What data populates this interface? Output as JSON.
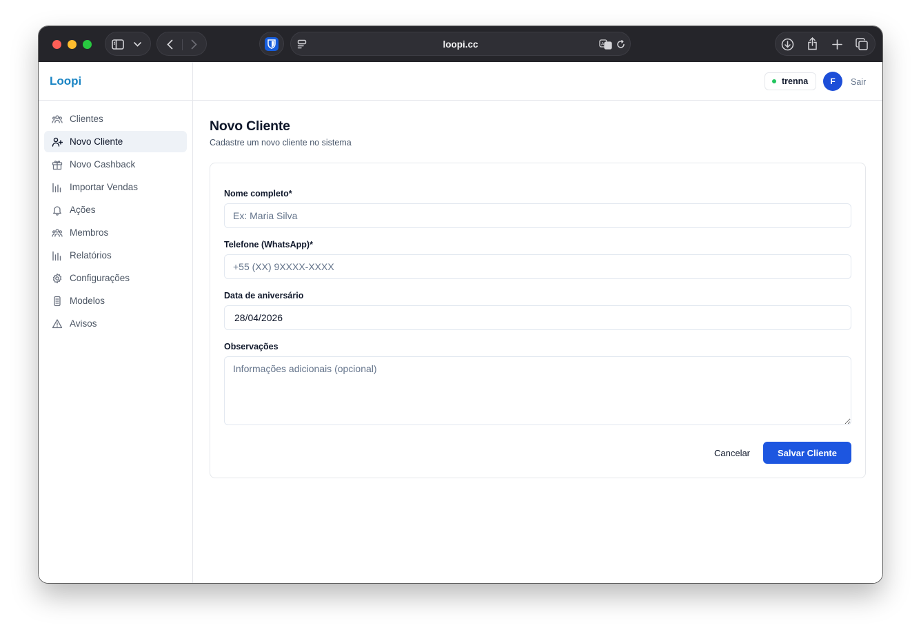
{
  "browser": {
    "url": "loopi.cc"
  },
  "app": {
    "brand": "Loopi"
  },
  "sidebar": {
    "items": [
      {
        "label": "Clientes",
        "icon": "users-icon",
        "active": false
      },
      {
        "label": "Novo Cliente",
        "icon": "user-plus-icon",
        "active": true
      },
      {
        "label": "Novo Cashback",
        "icon": "gift-icon",
        "active": false
      },
      {
        "label": "Importar Vendas",
        "icon": "bar-chart-icon",
        "active": false
      },
      {
        "label": "Ações",
        "icon": "bell-icon",
        "active": false
      },
      {
        "label": "Membros",
        "icon": "users-icon",
        "active": false
      },
      {
        "label": "Relatórios",
        "icon": "bar-chart-icon",
        "active": false
      },
      {
        "label": "Configurações",
        "icon": "gear-icon",
        "active": false
      },
      {
        "label": "Modelos",
        "icon": "file-icon",
        "active": false
      },
      {
        "label": "Avisos",
        "icon": "warning-icon",
        "active": false
      }
    ]
  },
  "header": {
    "tenant": "trenna",
    "avatar_initial": "F",
    "logout_label": "Sair"
  },
  "page": {
    "title": "Novo Cliente",
    "subtitle": "Cadastre um novo cliente no sistema"
  },
  "form": {
    "name_label": "Nome completo*",
    "name_placeholder": "Ex: Maria Silva",
    "name_value": "",
    "phone_label": "Telefone (WhatsApp)*",
    "phone_placeholder": "+55 (XX) 9XXXX-XXXX",
    "phone_value": "",
    "birthday_label": "Data de aniversário",
    "birthday_value": "28/04/2026",
    "notes_label": "Observações",
    "notes_placeholder": "Informações adicionais (opcional)",
    "cancel_label": "Cancelar",
    "save_label": "Salvar Cliente"
  },
  "colors": {
    "brand": "#1b85c4",
    "primary": "#1d56e0",
    "status_online": "#22c55e"
  }
}
